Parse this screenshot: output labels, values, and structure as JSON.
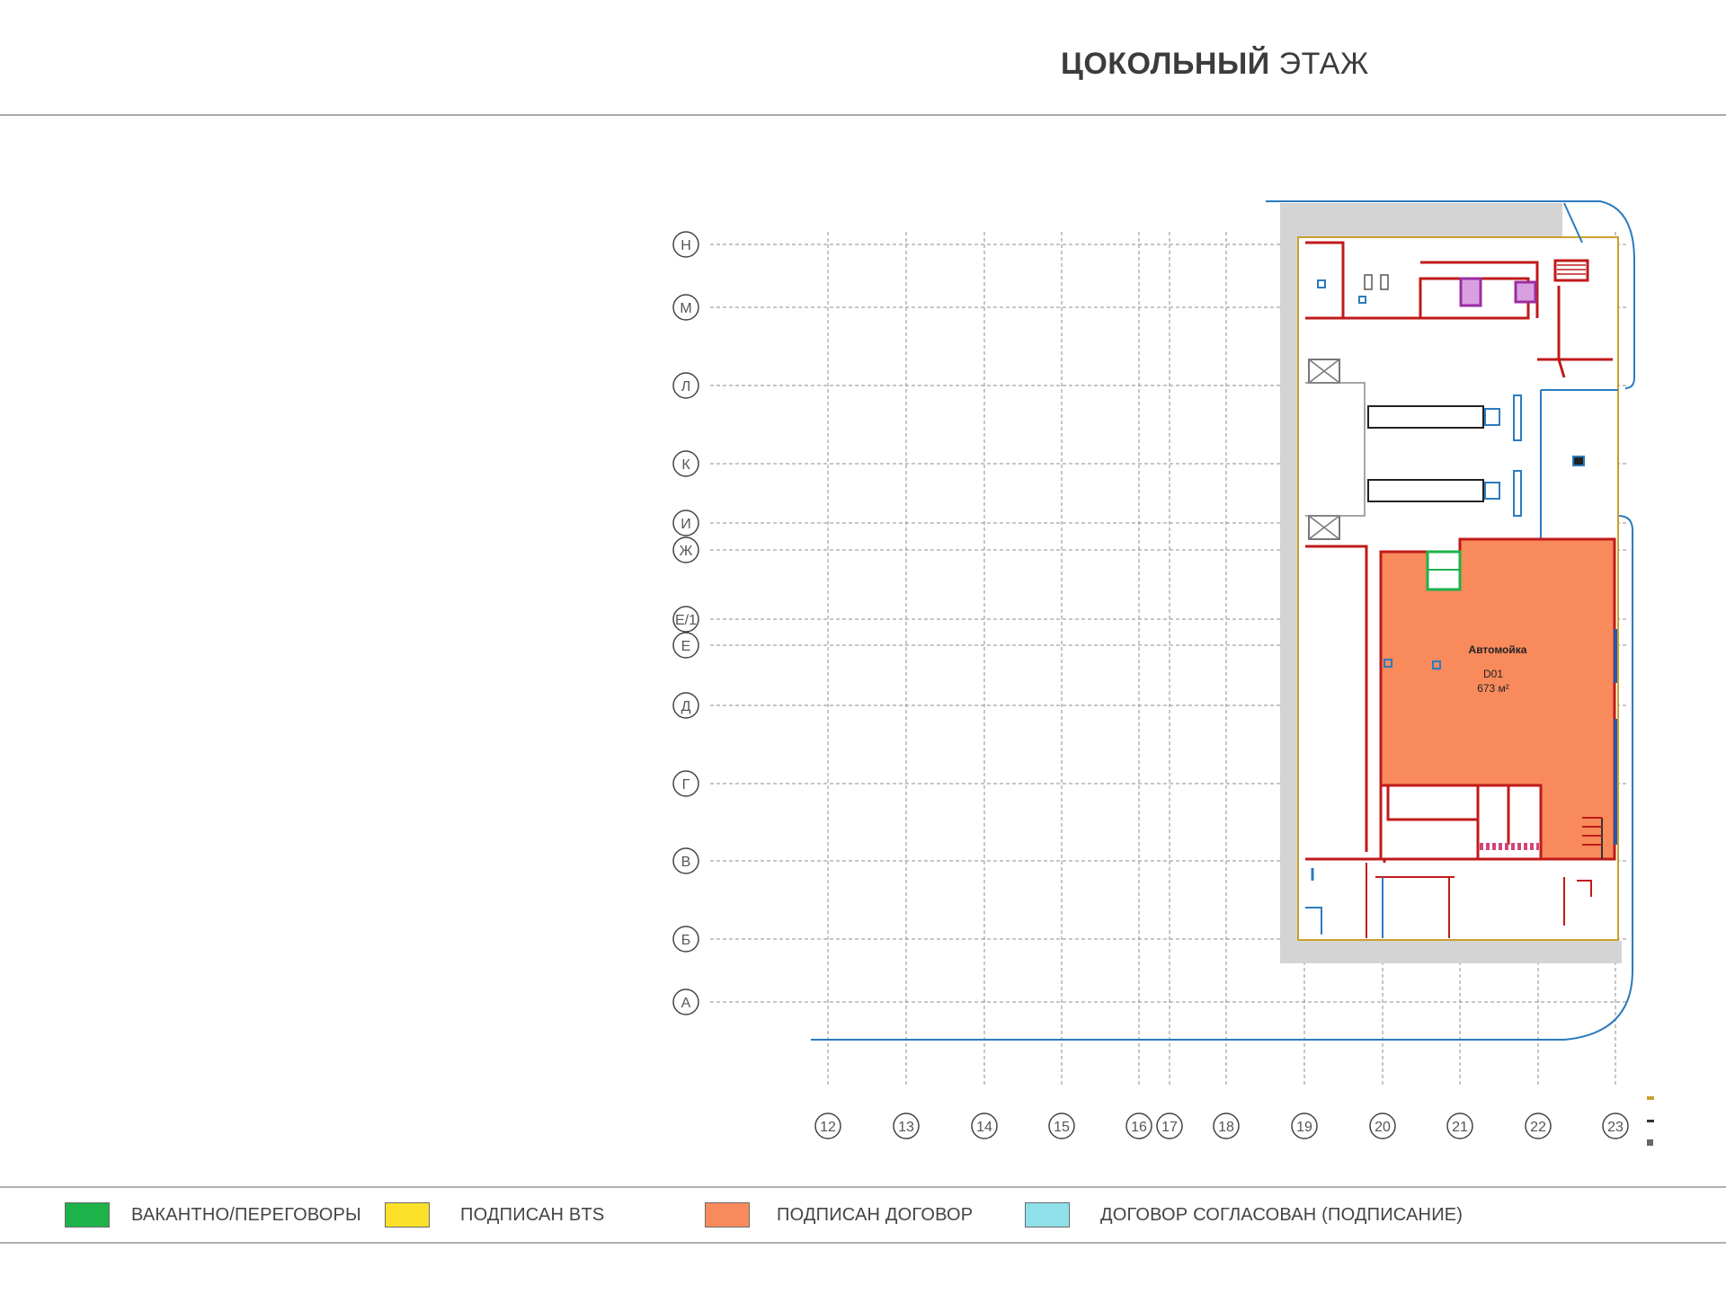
{
  "header": {
    "title_bold": "ЦОКОЛЬНЫЙ",
    "title_light": "ЭТАЖ"
  },
  "colors": {
    "vacant": "#1db24a",
    "bts": "#fde02a",
    "signed": "#f98a5c",
    "agreed": "#8fe0e8",
    "walls": "#c01a1a",
    "outline": "#2b7bbf",
    "grid": "#8c8c8c"
  },
  "plan": {
    "row_axes": [
      "Н",
      "М",
      "Л",
      "К",
      "И",
      "Ж",
      "Е/1",
      "Е",
      "Д",
      "Г",
      "В",
      "Б",
      "А"
    ],
    "column_axes": [
      "12",
      "13",
      "14",
      "15",
      "16",
      "17",
      "18",
      "19",
      "20",
      "21",
      "22",
      "23"
    ],
    "unit": {
      "name": "Автомойка",
      "code": "D01",
      "area": "673 м²",
      "status": "signed"
    }
  },
  "legend": [
    {
      "label": "ВАКАНТНО/ПЕРЕГОВОРЫ",
      "color": "#1db24a"
    },
    {
      "label": "ПОДПИСАН BTS",
      "color": "#fde02a"
    },
    {
      "label": "ПОДПИСАН ДОГОВОР",
      "color": "#f98a5c"
    },
    {
      "label": "ДОГОВОР СОГЛАСОВАН (ПОДПИСАНИЕ)",
      "color": "#8fe0e8"
    }
  ]
}
